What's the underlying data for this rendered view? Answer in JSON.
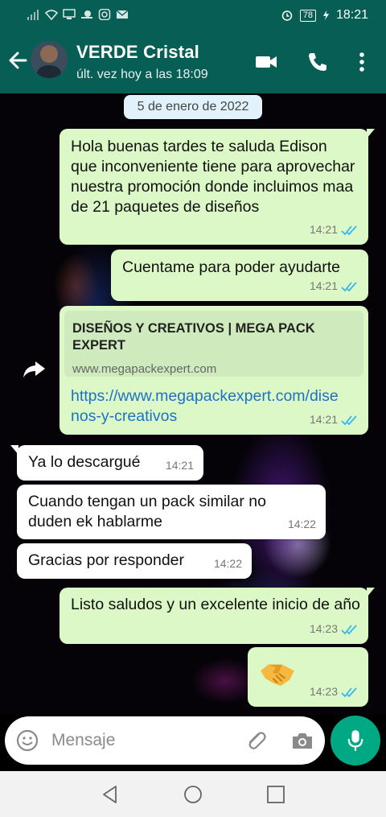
{
  "status_bar": {
    "time": "18:21",
    "battery": "78"
  },
  "header": {
    "name": "VERDE Cristal",
    "status": "últ. vez hoy a las 18:09"
  },
  "chat": {
    "date": "5 de enero de 2022",
    "messages": [
      {
        "dir": "out",
        "text": "Hola buenas tardes te saluda Edison que inconveniente tiene para aprovechar nuestra promoción donde incluimos maa de 21 paquetes de diseños",
        "time": "14:21",
        "read": true
      },
      {
        "dir": "out",
        "text": "Cuentame para poder ayudarte",
        "time": "14:21",
        "read": true
      },
      {
        "dir": "out",
        "link_title": "DISEÑOS Y CREATIVOS | MEGA PACK EXPERT",
        "link_domain": "www.megapackexpert.com",
        "text": "https://www.megapackexpert.com/disenos-y-creativos",
        "time": "14:21",
        "read": true
      },
      {
        "dir": "in",
        "text": "Ya lo descargué",
        "time": "14:21"
      },
      {
        "dir": "in",
        "text": "Cuando tengan un  pack similar no duden ek hablarme",
        "time": "14:22"
      },
      {
        "dir": "in",
        "text": "Gracias por responder",
        "time": "14:22"
      },
      {
        "dir": "out",
        "text": "Listo saludos y un excelente inicio de año",
        "time": "14:23",
        "read": true
      },
      {
        "dir": "out",
        "emoji": "handshake",
        "time": "14:23",
        "read": true
      }
    ]
  },
  "input": {
    "placeholder": "Mensaje"
  },
  "colors": {
    "header": "#075E54",
    "outgoing": "#dcf8c6",
    "incoming": "#ffffff",
    "mic": "#00a884",
    "read_ticks": "#34b7f1"
  }
}
